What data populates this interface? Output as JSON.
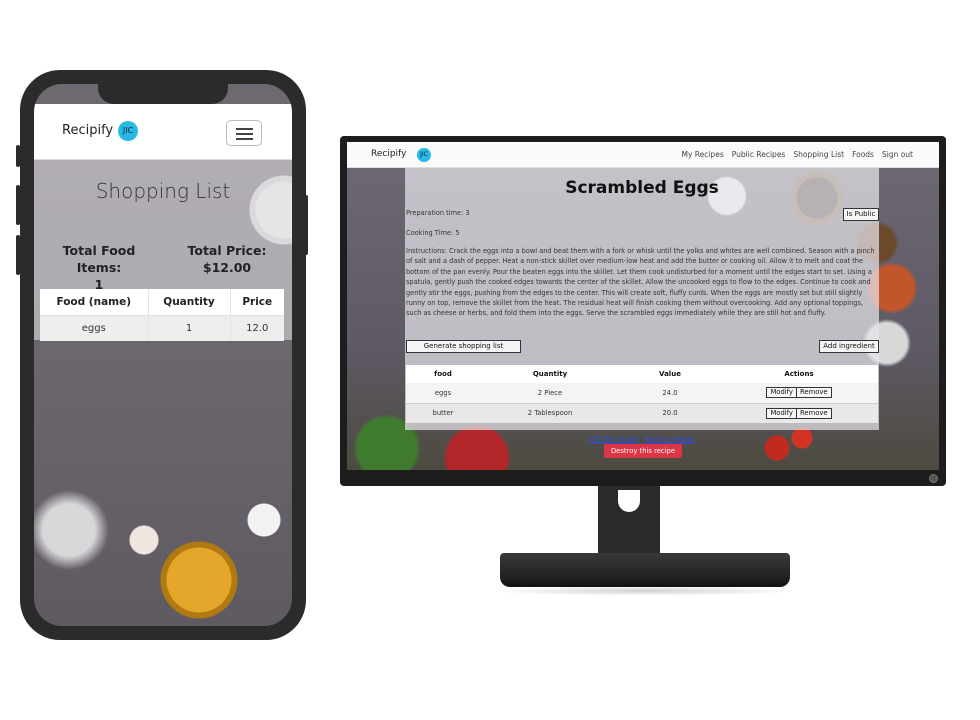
{
  "phone": {
    "brand": "Recipify",
    "avatar_initials": "JIC",
    "page_title": "Shopping List",
    "total_items_label": "Total Food Items:",
    "total_items_value": "1",
    "total_price_label": "Total Price: $12.00",
    "table": {
      "headers": [
        "Food (name)",
        "Quantity",
        "Price"
      ],
      "rows": [
        [
          "eggs",
          "1",
          "12.0"
        ]
      ]
    }
  },
  "desktop": {
    "brand": "Recipify",
    "avatar_initials": "JIC",
    "nav_links": [
      "My Recipes",
      "Public Recipes",
      "Shopping List",
      "Foods",
      "Sign out"
    ],
    "recipe_title": "Scrambled Eggs",
    "preparation_time": "Preparation time: 3",
    "cooking_time": "Cooking Time: 5",
    "is_public_label": "Is Public",
    "instructions": "Instructions: Crack the eggs into a bowl and beat them with a fork or whisk until the yolks and whites are well combined. Season with a pinch of salt and a dash of pepper. Heat a non-stick skillet over medium-low heat and add the butter or cooking oil. Allow it to melt and coat the bottom of the pan evenly. Pour the beaten eggs into the skillet. Let them cook undisturbed for a moment until the edges start to set. Using a spatula, gently push the cooked edges towards the center of the skillet. Allow the uncooked eggs to flow to the edges. Continue to cook and gently stir the eggs, pushing from the edges to the center. This will create soft, fluffy curds. When the eggs are mostly set but still slightly runny on top, remove the skillet from the heat. The residual heat will finish cooking them without overcooking. Add any optional toppings, such as cheese or herbs, and fold them into the eggs. Serve the scrambled eggs immediately while they are still hot and fluffy.",
    "generate_shopping_list": "Generate shopping list",
    "add_ingredient": "Add ingredient",
    "table": {
      "headers": [
        "food",
        "Quantity",
        "Value",
        "Actions"
      ],
      "rows": [
        {
          "food": "eggs",
          "quantity": "2 Piece",
          "value": "24.0"
        },
        {
          "food": "butter",
          "quantity": "2 Tablespoon",
          "value": "20.0"
        }
      ],
      "modify_label": "Modify",
      "remove_label": "Remove"
    },
    "edit_link": "Edit this recipe",
    "separator": "|",
    "back_link": "Back to recipes",
    "destroy_button": "Destroy this recipe"
  },
  "colors": {
    "avatar": "#27b8e6",
    "destroy": "#dc3545",
    "link": "#2a4dff",
    "device": "#2b2b2b"
  }
}
